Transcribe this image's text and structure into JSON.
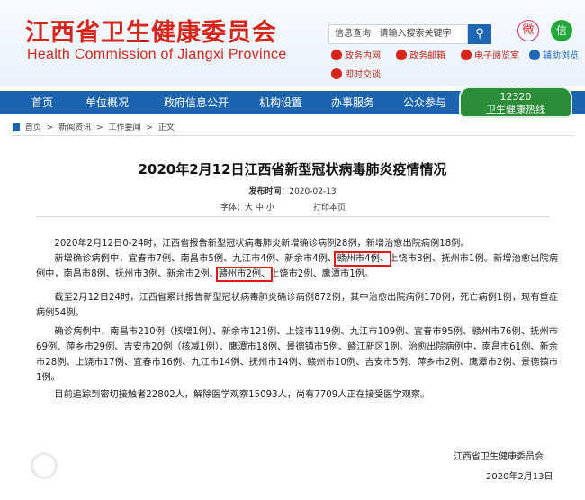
{
  "header": {
    "title": "江西省卫生健康委员会",
    "subtitle": "Health Commission of Jiangxi Province",
    "search_label": "信息查询",
    "search_placeholder": "请输入搜索关键字",
    "search_icon": "search-icon",
    "quick_links": [
      "政务内网",
      "政务邮箱",
      "电子阅览室",
      "辅助浏览",
      "即时交谈"
    ]
  },
  "nav": {
    "items": [
      "首页",
      "单位概况",
      "政府信息公开",
      "机构设置",
      "办事服务",
      "公众参与"
    ],
    "hotline_number": "12320",
    "hotline_label": "卫生健康热线"
  },
  "breadcrumb": [
    "首页",
    "新闻资讯",
    "工作要闻",
    "正文"
  ],
  "breadcrumb_sep": ">",
  "article": {
    "title": "2020年2月12日江西省新型冠状病毒肺炎疫情情况",
    "date_label": "发布时间：",
    "date": "2020-02-13",
    "font_size": "字体：大 中 小",
    "print": "打印本页",
    "p1": "2020年2月12日0-24时，江西省报告新型冠状病毒肺炎新增确诊病例28例，新增治愈出院病例18例。",
    "p2": {
      "a": "新增确诊病例中，宜春市7例、南昌市5例、九江市4例、新余市4例、",
      "b": "赣州市4例、",
      "c": "上饶市3例、抚州市1例。新增治愈出院病例中，南昌市8例、抚州市3例、新余市2例、",
      "d": "赣州市2例、",
      "e": "上饶市2例、鹰潭市1例。"
    },
    "p3": "截至2月12日24时，江西省累计报告新型冠状病毒肺炎确诊病例872例，其中治愈出院病例170例，死亡病例1例，现有重症病例54例。",
    "p4": "确诊病例中，南昌市210例（核增1例）、新余市121例、上饶市119例、九江市109例、宜春市95例、赣州市76例、抚州市69例、萍乡市29例、吉安市20例（核减1例）、鹰潭市18例、景德镇市5例、赣江新区1例。治愈出院病例中，南昌市61例、新余市28例、上饶市17例、宜春市16例、九江市14例、抚州市14例、赣州市10例、吉安市5例、萍乡市2例、鹰潭市2例、景德镇市1例。",
    "p5": "目前追踪到密切接触者22802人，解除医学观察15093人，尚有7709人正在接受医学观察。",
    "signoff": "江西省卫生健康委员会",
    "signoff_date": "2020年2月13日"
  },
  "colors": {
    "brand_red": "#d6261c",
    "nav_blue": "#1c63b0",
    "hotline_green": "#2c8d38",
    "highlight_red": "#e01a1a"
  }
}
